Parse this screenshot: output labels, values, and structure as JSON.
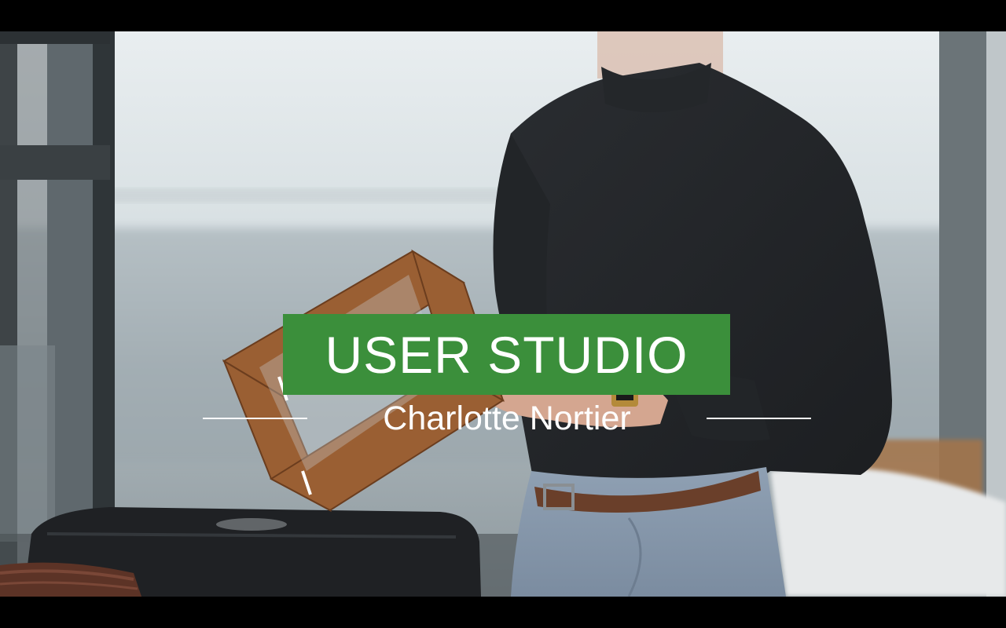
{
  "overlay": {
    "title": "USER STUDIO",
    "subtitle": "Charlotte Nortier"
  },
  "colors": {
    "title_background": "#3b8f3b",
    "title_text": "#ffffff",
    "subtitle_text": "#ffffff",
    "letterbox": "#000000"
  },
  "scene": {
    "description_icon": "video-frame-image"
  }
}
